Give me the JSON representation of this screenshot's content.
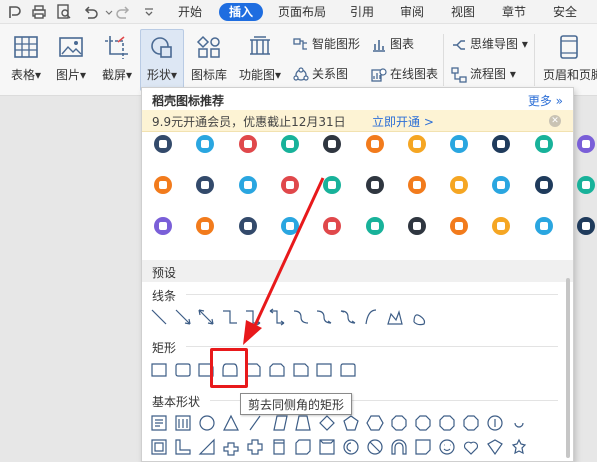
{
  "menubar": {
    "tabs": [
      "开始",
      "插入",
      "页面布局",
      "引用",
      "审阅",
      "视图",
      "章节",
      "安全"
    ],
    "active_tab": "插入"
  },
  "ribbon": {
    "table": "表格",
    "image": "图片",
    "screenshot": "截屏",
    "shapes": "形状",
    "icon_library": "图标库",
    "function_chart": "功能图",
    "smart_art": "智能图形",
    "chart": "图表",
    "relation": "关系图",
    "online_chart": "在线图表",
    "mind_map": "思维导图",
    "flow_chart": "流程图",
    "header_footer": "页眉和页脚"
  },
  "panel": {
    "title": "稻壳图标推荐",
    "more": "更多",
    "promo_text": "9.9元开通会员，优惠截止12月31日",
    "promo_link": "立即开通 >",
    "preset_label": "预设",
    "lines_label": "线条",
    "rect_label": "矩形",
    "basic_label": "基本形状",
    "tooltip": "剪去同侧角的矩形"
  },
  "colors": {
    "accent": "#1e6de0",
    "highlight": "#e8191b",
    "promo_bg": "#fdf3d4",
    "icon_palette": [
      "#f5a623",
      "#2aa6e0",
      "#e0484b",
      "#18b29a",
      "#7a5fd8",
      "#f27b1c"
    ]
  }
}
